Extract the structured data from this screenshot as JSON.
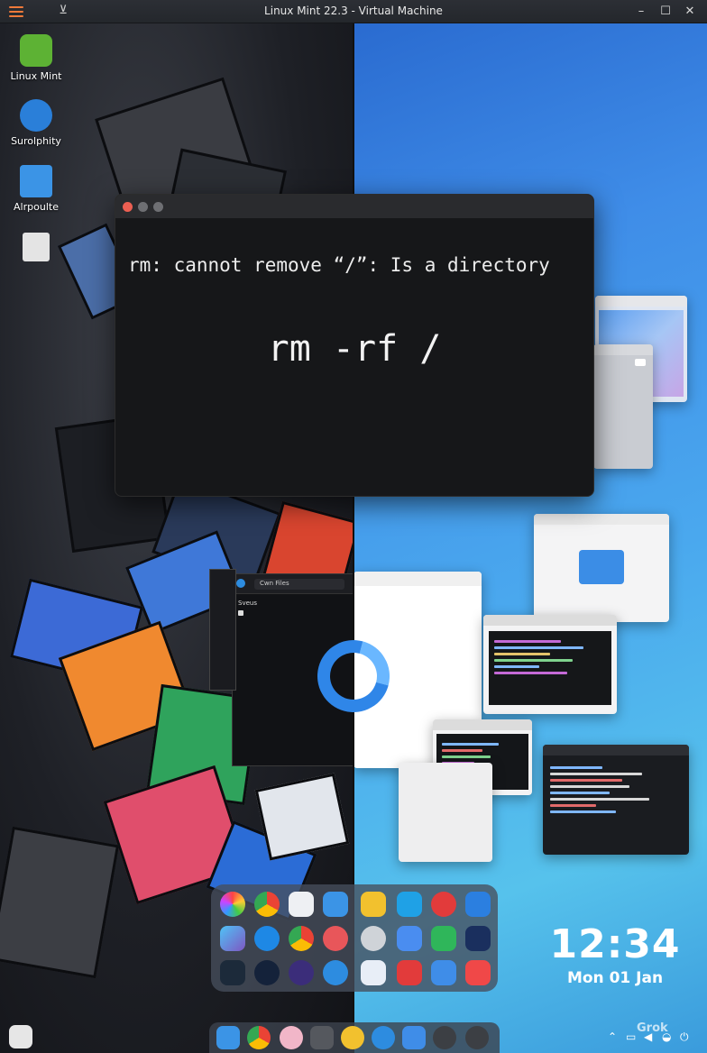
{
  "window": {
    "title": "Linux Mint 22.3 - Virtual Machine",
    "menu_icon": "hamburger-menu-icon",
    "pin_icon": "pin-icon",
    "minimize": "–",
    "maximize": "☐",
    "close": "✕"
  },
  "desktop_icons": [
    {
      "label": "Linux Mint",
      "icon": "linux-mint-logo-icon",
      "color": "#5db234"
    },
    {
      "label": "Surolphity",
      "icon": "app-logo-icon",
      "color": "#2a7fd9"
    },
    {
      "label": "Alrpoulte",
      "icon": "folder-icon",
      "color": "#3b94e6"
    },
    {
      "label": "",
      "icon": "document-icon",
      "color": "#e4e4e4"
    }
  ],
  "terminal": {
    "error_line": "rm: cannot remove “/”: Is a directory",
    "command": "rm -rf /"
  },
  "file_window": {
    "title": "Cwn Files",
    "sidebar_item": "Sveus"
  },
  "clock": {
    "time": "12:34",
    "date": "Mon 01 Jan"
  },
  "watermark": "Grok",
  "colors": {
    "accent_orange": "#f07a3a",
    "mint_green": "#5db234",
    "terminal_bg": "#161719",
    "right_bg": "#3f8de8"
  }
}
